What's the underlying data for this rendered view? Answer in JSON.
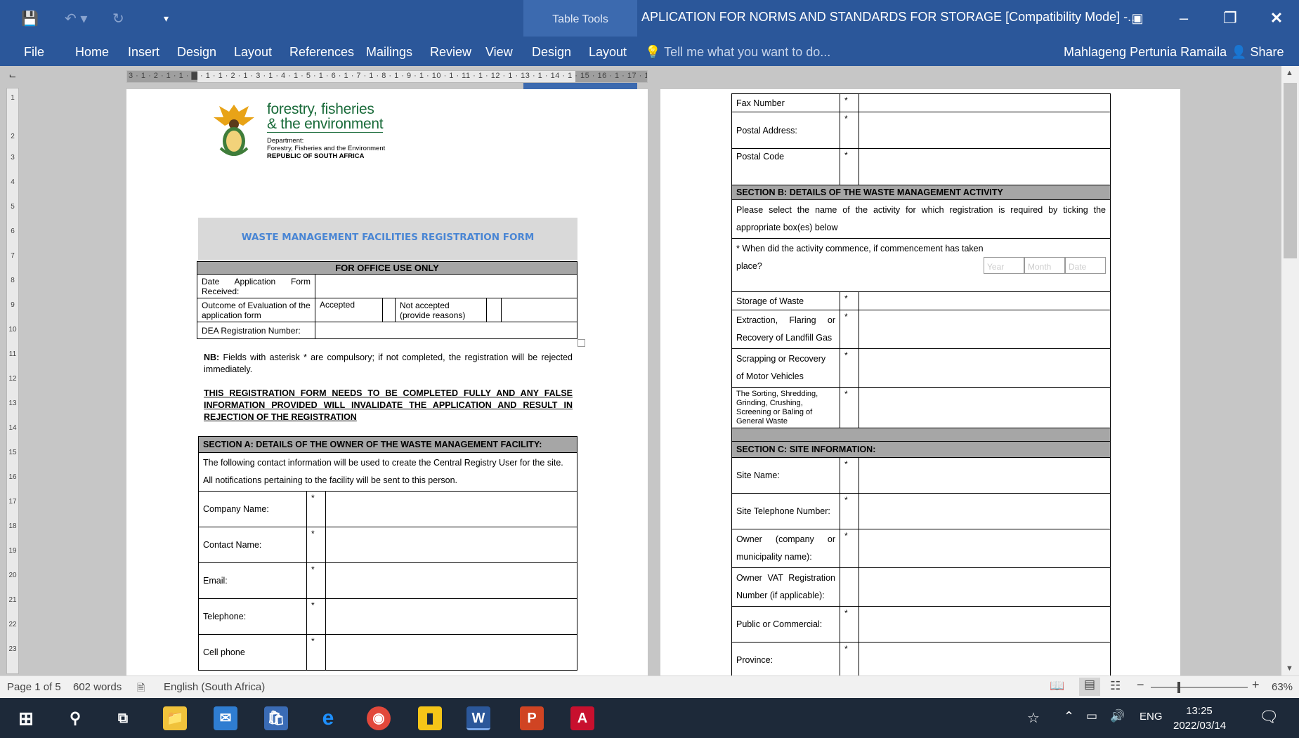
{
  "window": {
    "contextual_group": "Table Tools",
    "title": "APLICATION FOR NORMS AND STANDARDS FOR  STORAGE [Compatibility Mode] -...",
    "user": "Mahlageng Pertunia Ramaila",
    "share": "Share"
  },
  "ribbon": {
    "tabs": [
      "File",
      "Home",
      "Insert",
      "Design",
      "Layout",
      "References",
      "Mailings",
      "Review",
      "View"
    ],
    "table_tabs": [
      "Design",
      "Layout"
    ],
    "tell_me": "Tell me what you want to do..."
  },
  "ruler": {
    "horizontal": "3 · 1 · 2 · 1 · 1 · ▇ · 1 · 1 · 2 · 1 · 3 · 1 · 4 · 1 · 5 · 1 · 6 · 1 · 7 · 1 · 8 · 1 · 9 · 1 · 10 · 1 · 11 · 1 · 12 · 1 · 13 · 1 · 14 · 1 · 15 · 16 · 1 · 17 · 1 · 18",
    "vertical": [
      "1",
      "2",
      "1",
      "3",
      "4",
      "5",
      "6",
      "7",
      "8",
      "9",
      "10",
      "11",
      "12",
      "13",
      "14",
      "15",
      "16",
      "17",
      "18",
      "19",
      "20",
      "21",
      "22",
      "23"
    ]
  },
  "page1": {
    "logo": {
      "line1": "forestry, fisheries",
      "line2": "& the environment",
      "dept1": "Department:",
      "dept2": "Forestry, Fisheries and the Environment",
      "dept3": "REPUBLIC OF SOUTH AFRICA"
    },
    "form_title": "WASTE MANAGEMENT FACILITIES REGISTRATION FORM",
    "office": {
      "header": "FOR OFFICE USE ONLY",
      "date_received": "Date Application Form Received:",
      "outcome": "Outcome of Evaluation of the application form",
      "accepted": "Accepted",
      "not_accepted": "Not accepted (provide reasons)",
      "dea_number": "DEA Registration Number:"
    },
    "nb_label": "NB:",
    "nb_text": "Fields with asterisk * are compulsory; if not completed, the registration will be rejected immediately.",
    "warning": "THIS REGISTRATION FORM NEEDS TO BE COMPLETED FULLY AND ANY FALSE INFORMATION PROVIDED WILL INVALIDATE THE APPLICATION AND RESULT IN REJECTION OF THE REGISTRATION",
    "section_a": {
      "header": "SECTION A: DETAILS OF THE OWNER OF THE WASTE MANAGEMENT FACILITY:",
      "intro": "The following contact information will be used to create the Central Registry User for the site. All notifications pertaining to the facility will be sent to this person.",
      "fields": [
        "Company Name:",
        "Contact Name:",
        "Email:",
        "Telephone:",
        "Cell phone"
      ]
    }
  },
  "page2": {
    "top_fields": [
      "Fax Number",
      "Postal Address:",
      "Postal Code"
    ],
    "section_b": {
      "header": "SECTION B: DETAILS OF THE WASTE MANAGEMENT ACTIVITY",
      "intro": "Please select the name of the activity for which registration is required by ticking the appropriate box(es) below",
      "commence_q1": "* When did the activity commence, if commencement has taken",
      "commence_q2": "place?",
      "year": "Year",
      "month": "Month",
      "date": "Date",
      "activities": [
        "Storage of Waste",
        "Extraction, Flaring or Recovery of Landfill Gas",
        "Scrapping or Recovery of Motor Vehicles",
        "The Sorting, Shredding, Grinding, Crushing, Screening or Baling of General Waste"
      ]
    },
    "section_c": {
      "header": "SECTION C: SITE INFORMATION:",
      "fields": [
        "Site Name:",
        "Site Telephone Number:",
        "Owner (company or municipality name):",
        "Owner VAT Registration Number (if applicable):",
        "Public or Commercial:",
        "Province:"
      ]
    },
    "asterisk": "*"
  },
  "status": {
    "page": "Page 1 of 5",
    "words": "602 words",
    "language": "English (South Africa)",
    "zoom": "63%"
  },
  "taskbar": {
    "lang": "ENG",
    "time": "13:25",
    "date": "2022/03/14"
  }
}
